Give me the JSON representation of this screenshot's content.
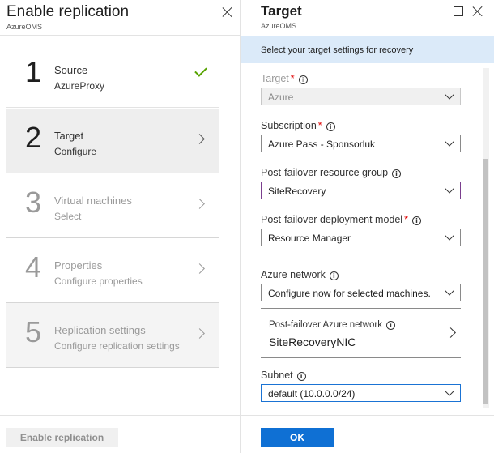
{
  "left_blade": {
    "title": "Enable replication",
    "subtitle": "AzureOMS",
    "steps": [
      {
        "number": "1",
        "name": "Source",
        "sub": "AzureProxy",
        "state": "complete"
      },
      {
        "number": "2",
        "name": "Target",
        "sub": "Configure",
        "state": "selected"
      },
      {
        "number": "3",
        "name": "Virtual machines",
        "sub": "Select",
        "state": "disabled"
      },
      {
        "number": "4",
        "name": "Properties",
        "sub": "Configure properties",
        "state": "disabled"
      },
      {
        "number": "5",
        "name": "Replication settings",
        "sub": "Configure replication settings",
        "state": "disabled"
      }
    ],
    "enable_button_label": "Enable replication"
  },
  "right_blade": {
    "title": "Target",
    "subtitle": "AzureOMS",
    "banner": "Select your target settings for recovery",
    "fields": {
      "target": {
        "label": "Target",
        "value": "Azure",
        "required": true,
        "disabled": true
      },
      "subscription": {
        "label": "Subscription",
        "value": "Azure Pass - Sponsorluk",
        "required": true
      },
      "resource_group": {
        "label": "Post-failover resource group",
        "value": "SiteRecovery",
        "required": false
      },
      "deployment_model": {
        "label": "Post-failover deployment model",
        "value": "Resource Manager",
        "required": true
      },
      "azure_network": {
        "label": "Azure network",
        "value": "Configure now for selected machines.",
        "required": false
      },
      "post_failover_network": {
        "label": "Post-failover Azure network",
        "value": "SiteRecoveryNIC"
      },
      "subnet": {
        "label": "Subnet",
        "value": "default (10.0.0.0/24)",
        "required": false
      }
    },
    "ok_button_label": "OK"
  },
  "symbols": {
    "required_mark": "*",
    "info_glyph": "i"
  },
  "colors": {
    "accent_blue": "#0f70d4",
    "banner_blue": "#dbeaf9",
    "required_red": "#e00000",
    "check_green": "#57a300"
  }
}
